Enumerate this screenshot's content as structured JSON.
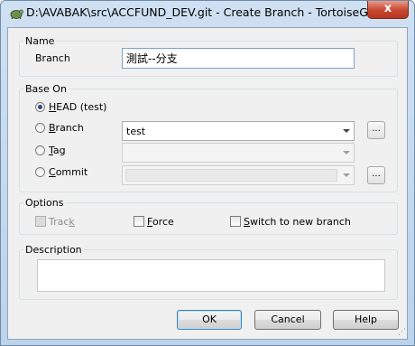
{
  "window": {
    "title": "D:\\AVABAK\\src\\ACCFUND_DEV.git - Create Branch - TortoiseGit",
    "close_glyph": "x",
    "icon": "tortoise-icon"
  },
  "name_group": {
    "title": "Name",
    "branch_label": "Branch",
    "branch_value": "測試--分支"
  },
  "base_on": {
    "title": "Base On",
    "head_prefix": "H",
    "head_rest": "EAD (test)",
    "branch_prefix": "B",
    "branch_rest": "ranch",
    "branch_value": "test",
    "tag_prefix": "T",
    "tag_rest": "ag",
    "commit_prefix": "C",
    "commit_rest": "ommit",
    "browse_label": "...",
    "selected": "head"
  },
  "options": {
    "title": "Options",
    "track_pre": "Trac",
    "track_u": "k",
    "force_pre": "",
    "force_u": "F",
    "force_rest": "orce",
    "switch_u": "S",
    "switch_rest": "witch to new branch"
  },
  "description": {
    "title": "Description"
  },
  "buttons": {
    "ok": "OK",
    "cancel": "Cancel",
    "help": "Help"
  },
  "colors": {
    "close": "#c7462f",
    "frame": "#bcd3ec",
    "client": "#f0f0f0"
  }
}
